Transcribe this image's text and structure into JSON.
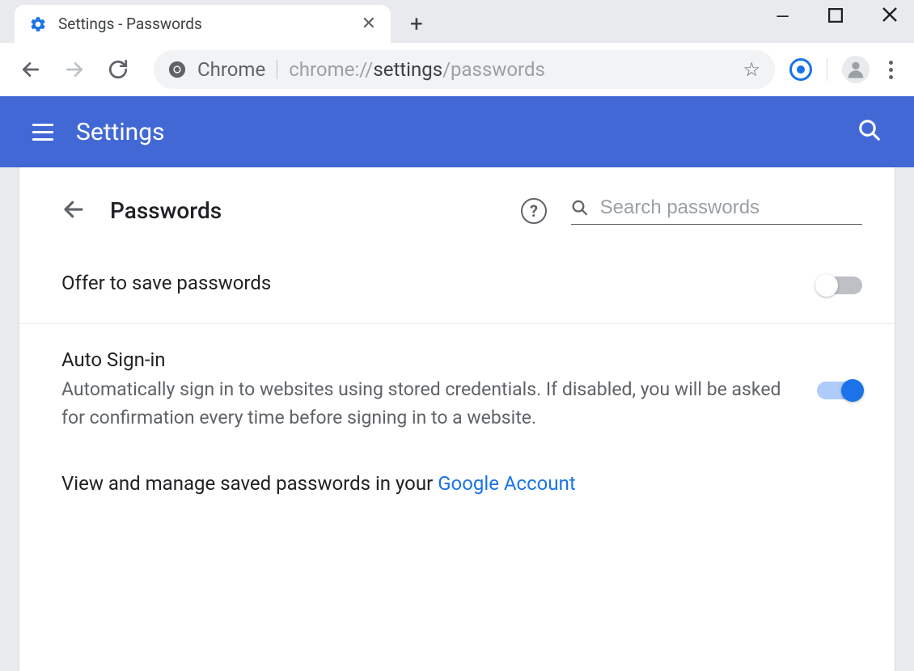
{
  "browser": {
    "tab_title": "Settings - Passwords",
    "omnibox_label": "Chrome",
    "url_prefix": "chrome://",
    "url_strong": "settings",
    "url_suffix": "/passwords"
  },
  "app": {
    "title": "Settings"
  },
  "page": {
    "title": "Passwords",
    "search_placeholder": "Search passwords"
  },
  "settings": {
    "offer_save": {
      "title": "Offer to save passwords"
    },
    "auto_signin": {
      "title": "Auto Sign-in",
      "desc": "Automatically sign in to websites using stored credentials. If disabled, you will be asked for confirmation every time before signing in to a website."
    },
    "manage": {
      "prefix": "View and manage saved passwords in your ",
      "link": "Google Account"
    }
  }
}
